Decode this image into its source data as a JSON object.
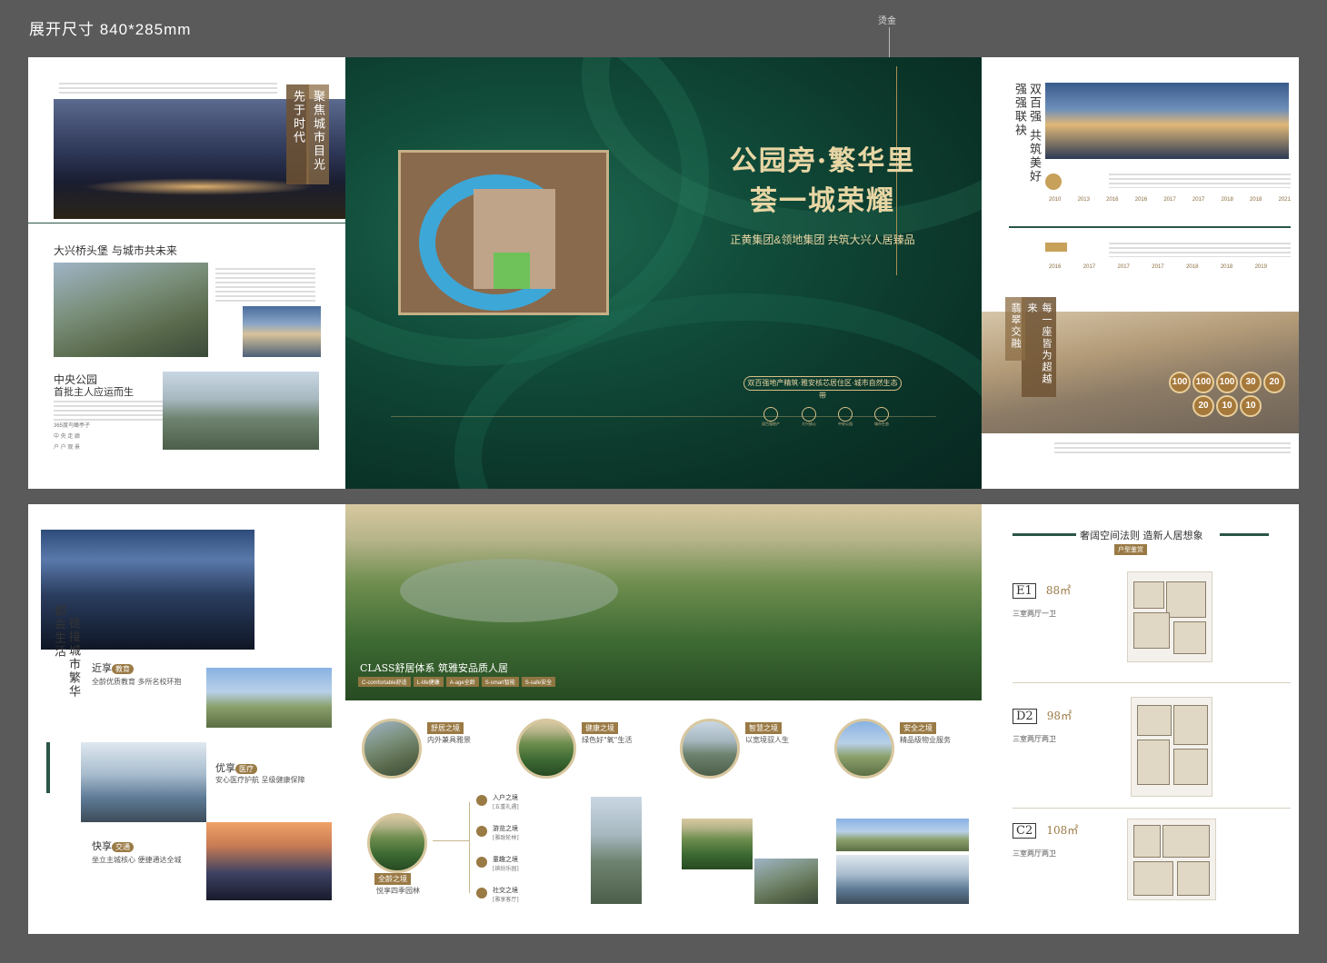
{
  "header": {
    "size_label": "展开尺寸 840*285mm",
    "foil_label": "烫金"
  },
  "top_left": {
    "tag1": "先于时代",
    "tag2": "聚焦城市目光",
    "section1_title": "大兴桥头堡 与城市共未来",
    "section2_title": "中央公园",
    "section2_sub": "首批主人应运而生",
    "list": [
      "365度鸟瞰亭子",
      "中 央 走 廊",
      "户 户 观 景"
    ]
  },
  "cover": {
    "title_line1": "公园旁·繁华里",
    "title_line2": "荟一城荣耀",
    "subtitle": "正黄集团&领地集团 共筑大兴人居臻品",
    "pill": "双百强地产精筑·雅安核芯居住区·城市自然生态带",
    "icons": [
      "双百强地产",
      "大兴核心",
      "中央公园",
      "城市生态"
    ]
  },
  "top_right": {
    "tag1": "双百强 共筑美好",
    "tag2": "强强联袂",
    "tag3": "每一座皆为超越来",
    "tag4": "翡翠交融",
    "years_row1": [
      "2010",
      "2013",
      "2016",
      "2016",
      "2017",
      "2017",
      "2018",
      "2018",
      "2021"
    ],
    "years_row2": [
      "2016",
      "2017",
      "2017",
      "2017",
      "2018",
      "2018",
      "2019"
    ],
    "badges_row1": [
      "100",
      "100",
      "100",
      "30",
      "20"
    ],
    "badges_row2": [
      "20",
      "10",
      "10"
    ]
  },
  "bottom_left": {
    "tag1": "链接城市繁华",
    "tag2": "都会生活",
    "edu_title_pre": "近享",
    "edu_title_key": "教育",
    "edu_sub": "全龄优质教育 多所名校环抱",
    "med_title_pre": "优享",
    "med_title_key": "医疗",
    "med_sub": "安心医疗护航 呈级健康保障",
    "traffic_title_pre": "快享",
    "traffic_title_key": "交通",
    "traffic_sub": "坐立主城核心 便捷通达全城"
  },
  "bottom_center": {
    "banner_title": "CLASS舒居体系 筑雅安品质人居",
    "chips": [
      "C-comfortable舒适",
      "L-life健康",
      "A-age全龄",
      "S-smart智能",
      "S-safe安全"
    ],
    "circles": [
      {
        "chip": "舒居之境",
        "sub": "内外兼具雅景"
      },
      {
        "chip": "健康之境",
        "sub": "绿色好\"氧\"生活"
      },
      {
        "chip": "智慧之境",
        "sub": "以宽境驭人生"
      },
      {
        "chip": "安全之境",
        "sub": "精品级物业服务"
      }
    ],
    "age_chip": "全龄之境",
    "age_sub": "悦享四季园林",
    "tree": [
      {
        "title": "入户之境",
        "sub": "[五重礼遇]"
      },
      {
        "title": "游览之境",
        "sub": "[雅致轮林]"
      },
      {
        "title": "童趣之境",
        "sub": "[缤纷乐园]"
      },
      {
        "title": "社交之境",
        "sub": "[雅享客厅]"
      }
    ]
  },
  "bottom_right": {
    "title": "奢阔空间法则 造新人居想象",
    "subtitle": "户型鉴赏",
    "units": [
      {
        "code": "E1",
        "size": "88㎡",
        "desc": "三室两厅一卫"
      },
      {
        "code": "D2",
        "size": "98㎡",
        "desc": "三室两厅两卫"
      },
      {
        "code": "C2",
        "size": "108㎡",
        "desc": "三室两厅两卫"
      }
    ]
  },
  "colors": {
    "cover_green": "#0f4a38",
    "gold": "#9a7a45",
    "background": "#5a5a5a"
  }
}
